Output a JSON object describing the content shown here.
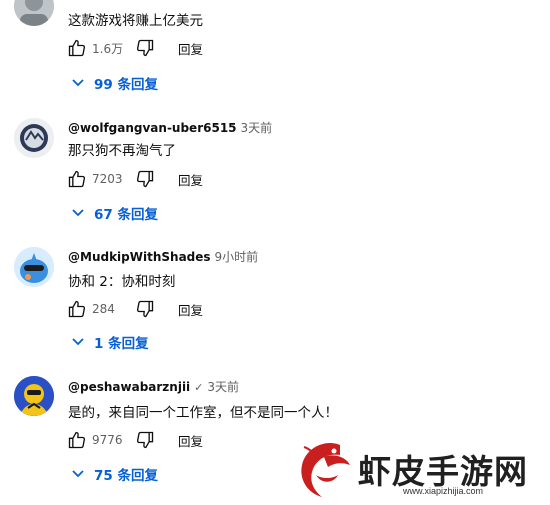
{
  "comments": [
    {
      "author": "",
      "time": "",
      "text": "这款游戏将赚上亿美元",
      "likes": "1.6万",
      "reply_label": "回复",
      "replies_label": "99 条回复"
    },
    {
      "author": "@wolfgangvan-uber6515",
      "time": "3天前",
      "text": "那只狗不再淘气了",
      "likes": "7203",
      "reply_label": "回复",
      "replies_label": "67 条回复"
    },
    {
      "author": "@MudkipWithShades",
      "time": "9小时前",
      "text": "协和 2：协和时刻",
      "likes": "284",
      "reply_label": "回复",
      "replies_label": "1 条回复"
    },
    {
      "author": "@peshawabarznjii",
      "verified": "✓",
      "time": "3天前",
      "text": "是的，来自同一个工作室，但不是同一个人！",
      "likes": "9776",
      "reply_label": "回复",
      "replies_label": "75 条回复"
    }
  ],
  "watermark": {
    "title": "虾皮手游网",
    "url": "www.xiapizhijia.com"
  },
  "colors": {
    "link": "#065fd4",
    "meta": "#606060",
    "text": "#0f0f0f"
  },
  "icons": [
    "like-icon",
    "dislike-icon",
    "chevron-down-icon"
  ]
}
